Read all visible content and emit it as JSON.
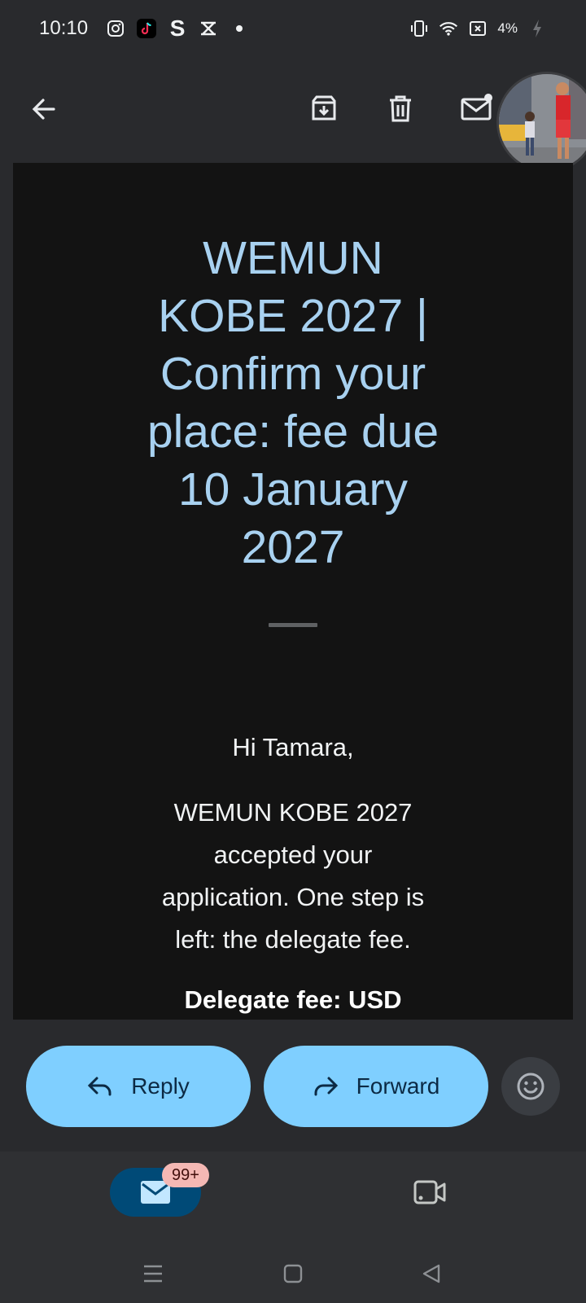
{
  "status_bar": {
    "time": "10:10",
    "battery": "4%"
  },
  "email": {
    "title": "WEMUN KOBE 2027 | Confirm your place: fee due 10 January 2027",
    "greeting": "Hi Tamara,",
    "intro": "WEMUN KOBE 2027 accepted your application. One step is left: the delegate fee.",
    "fee_line": "Delegate fee: USD"
  },
  "actions": {
    "reply_label": "Reply",
    "forward_label": "Forward"
  },
  "bottom_nav": {
    "mail_badge": "99+"
  },
  "colors": {
    "title": "#a8d1f0",
    "pill": "#7fcfff",
    "mail_active": "#004a77",
    "badge": "#f4b8b4"
  }
}
